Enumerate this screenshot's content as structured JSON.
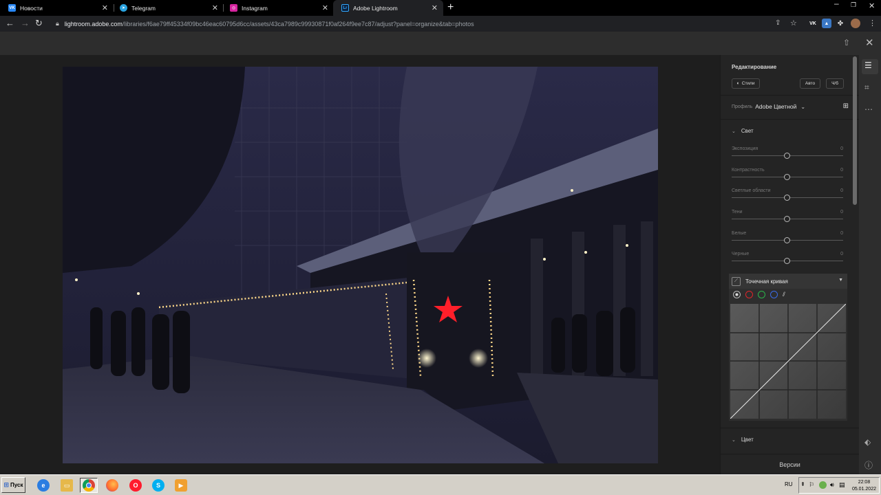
{
  "browser": {
    "tabs": [
      {
        "label": "Новости",
        "icon": "vk-icon",
        "color": "#2787f5",
        "glyph": "VK"
      },
      {
        "label": "Telegram",
        "icon": "telegram-icon",
        "color": "#2aa3df",
        "glyph": "➤"
      },
      {
        "label": "Instagram",
        "icon": "instagram-icon",
        "color": "#d6249f",
        "glyph": "◎"
      },
      {
        "label": "Adobe Lightroom",
        "icon": "lightroom-icon",
        "color": "#0b1f3a",
        "glyph": "Lr"
      }
    ],
    "url_host": "lightroom.adobe.com",
    "url_path": "/libraries/f6ae79ff45334f09bc46eac60795d6cc/assets/43ca7989c99930871f0af264f9ee7c87/adjust?panel=organize&tab=photos"
  },
  "editor": {
    "title": "Редактирование",
    "styles_label": "Стили",
    "auto_label": "Авто",
    "bw_label": "Ч/б",
    "profile_label": "Профиль",
    "profile_value": "Adobe Цветной",
    "light_section": "Свет",
    "sliders": [
      {
        "label": "Экспозиция",
        "value": "0"
      },
      {
        "label": "Контрастность",
        "value": "0"
      },
      {
        "label": "Светлые области",
        "value": "0"
      },
      {
        "label": "Тени",
        "value": "0"
      },
      {
        "label": "Белые",
        "value": "0"
      },
      {
        "label": "Черные",
        "value": "0"
      }
    ],
    "curve_title": "Точечная кривая",
    "color_section": "Цвет",
    "versions_label": "Версии"
  },
  "taskbar": {
    "start_label": "Пуск",
    "lang": "RU",
    "time": "22:08",
    "date": "05.01.2022"
  }
}
